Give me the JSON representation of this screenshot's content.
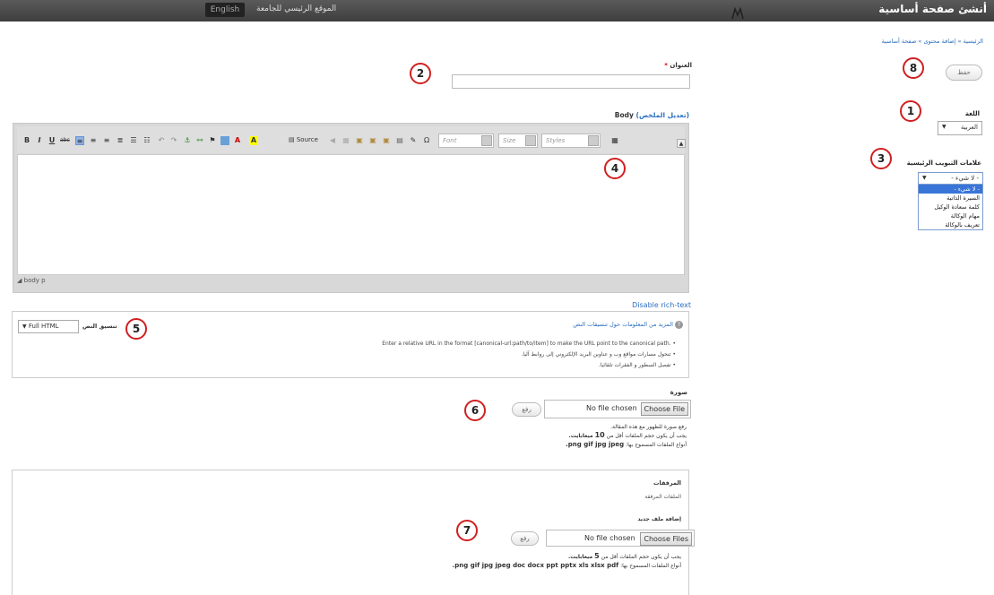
{
  "topbar": {
    "site_home": "الموقع الرئيسي للجامعة",
    "english_label": "English",
    "page_heading": "أنشئ صفحة أساسية"
  },
  "breadcrumb": "الرئيسية » إضافة محتوى » صفحة أساسية",
  "markers": [
    "1",
    "2",
    "3",
    "4",
    "5",
    "6",
    "7",
    "8"
  ],
  "save_button": "حفظ",
  "language": {
    "label": "اللغة",
    "selected": "العربية"
  },
  "menu": {
    "label": "علامات التبويب الرئيسية",
    "selected": "- لا شيء -",
    "options": [
      "- لا شيء -",
      "السيرة الذاتية",
      "كلمة سعادة الوكيل",
      "مهام الوكالة",
      "تعريف بالوكالة"
    ]
  },
  "title_field": {
    "label": "العنوان",
    "required_mark": "*"
  },
  "body_field": {
    "label": "Body",
    "summary_link": "(تعديل الملخص)"
  },
  "editor": {
    "source_label": "Source",
    "font_placeholder": "Font",
    "size_placeholder": "Size",
    "styles_placeholder": "Styles",
    "status_path": "body p",
    "disable_rich_text": "Disable rich-text"
  },
  "text_format": {
    "label": "تنسيق النص",
    "selected": "Full HTML",
    "help_link": "المزيد من المعلومات حول تنسيقات النص",
    "tips": [
      "Enter a relative URL in the format [canonical-url:path/to/item] to make the URL point to the canonical path.",
      "تتحول مسارات مواقع وب و عناوين البريد الإلكتروني إلى روابط آليا.",
      "تفصل السطور و الفقرات تلقائيا."
    ]
  },
  "image_field": {
    "label": "صورة",
    "upload_button": "رفع",
    "no_file": "No file chosen",
    "choose": "Choose File",
    "hint_1": "رفع صورة للظهور مع هذه المقالة.",
    "hint_2_prefix": "يجب أن يكون حجم الملفات أقل من",
    "hint_2_size": "10",
    "hint_2_unit": "ميغابايت.",
    "hint_3_prefix": "أنواع الملفات المسموح بها:",
    "hint_3_types": "png gif jpg jpeg."
  },
  "attachments": {
    "title": "المرفقات",
    "subtitle": "الملفات المرفقة",
    "add_label": "إضافة ملف جديد",
    "upload_button": "رفع",
    "no_file": "No file chosen",
    "choose": "Choose Files",
    "hint_1_prefix": "يجب أن يكون حجم الملفات أقل من",
    "hint_1_size": "5",
    "hint_1_unit": "ميغابايت.",
    "hint_2_prefix": "أنواع الملفات المسموح بها:",
    "hint_2_types": "png gif jpg jpeg doc docx ppt pptx xls xlsx pdf."
  },
  "toolbar_icons": [
    "bold-icon",
    "italic-icon",
    "underline-icon",
    "strikethrough-icon",
    "align-left-icon",
    "align-center-icon",
    "align-right-icon",
    "justify-icon",
    "bulleted-list-icon",
    "numbered-list-icon",
    "undo-icon",
    "redo-icon",
    "link-icon",
    "unlink-icon",
    "anchor-icon",
    "image-icon",
    "text-color-icon",
    "background-color-icon",
    "source-icon",
    "table-icon"
  ]
}
